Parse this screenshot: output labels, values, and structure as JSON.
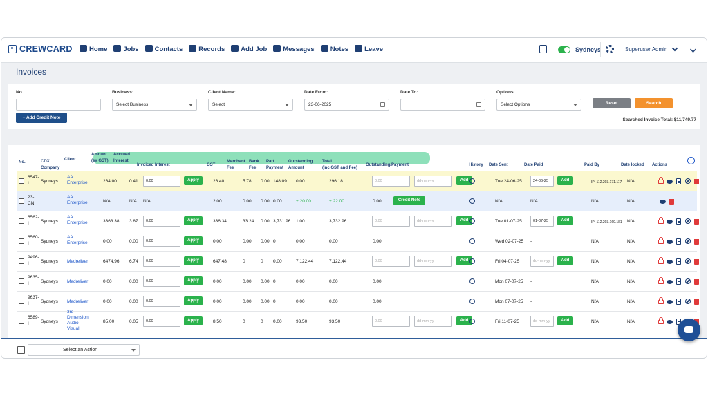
{
  "brand": {
    "name": "CREWCARD"
  },
  "nav": [
    {
      "label": "Home",
      "icon": "home-icon"
    },
    {
      "label": "Jobs",
      "icon": "list-icon"
    },
    {
      "label": "Contacts",
      "icon": "contact-icon"
    },
    {
      "label": "Records",
      "icon": "records-icon"
    },
    {
      "label": "Add Job",
      "icon": "plus-square-icon"
    },
    {
      "label": "Messages",
      "icon": "chat-bubbles-icon"
    },
    {
      "label": "Notes",
      "icon": "note-icon"
    },
    {
      "label": "Leave",
      "icon": "calendar-x-icon"
    }
  ],
  "topright": {
    "location": "Sydneys",
    "user": "Superuser Admin"
  },
  "page": {
    "title": "Invoices"
  },
  "filters": {
    "no_label": "No.",
    "no_value": "",
    "business_label": "Business:",
    "business_value": "Select Business",
    "client_label": "Client Name:",
    "client_value": "Select",
    "date_from_label": "Date From:",
    "date_from_value": "23-06-2025",
    "date_to_label": "Date To:",
    "date_to_value": "",
    "options_label": "Options:",
    "options_value": "Select Options",
    "reset": "Reset",
    "search": "Search",
    "add_credit_note": "+ Add Credit Note",
    "total_text": "Searched Invoice Total: $11,749.77"
  },
  "columns": {
    "no": "No.",
    "cdx": [
      "CDX",
      "Company"
    ],
    "client": "Client",
    "amount": [
      "Amount",
      "(ex GST)"
    ],
    "accrued": [
      "Accrued",
      "Interest"
    ],
    "invoiced": "Invoiced Interest",
    "gst": "GST",
    "merchant": [
      "Merchant",
      "Fee"
    ],
    "bank": [
      "Bank",
      "Fee"
    ],
    "part": [
      "Part",
      "Payment"
    ],
    "outstanding": [
      "Outstanding",
      "Amount"
    ],
    "total": [
      "Total",
      "(inc GST and Fee)"
    ],
    "outpay": "Outstanding/Payment",
    "history": "History",
    "date_sent": "Date Sent",
    "date_paid": "Date Paid",
    "paid_by": "Paid By",
    "date_locked": "Date locked",
    "actions": "Actions"
  },
  "labels": {
    "apply": "Apply",
    "add": "Add",
    "credit_note": "Credit Note",
    "placeholder_amt": "0.00",
    "placeholder_date": "dd-mm-yy"
  },
  "rows": [
    {
      "no": [
        "6547-",
        "I"
      ],
      "cdx": "Sydneys",
      "client": [
        "AA",
        "Enterprise"
      ],
      "amount": "264.00",
      "accrued": "0.41",
      "invoiced": "0.00",
      "gst": "26.40",
      "merchant": "5.78",
      "bank": "0.00",
      "part": "148.09",
      "outstanding": "0.00",
      "total": "296.18",
      "outpay": "",
      "date_sent": "Tue 24-06-25",
      "date_paid": "24-06-25",
      "paid_by": "IP: 112.203.171.117",
      "locked": "N/A",
      "bg": "#fbf8cf",
      "type": "invoice",
      "apply": true,
      "add": true,
      "paid_input": true
    },
    {
      "no": [
        "23-",
        "CN"
      ],
      "cdx": "",
      "client": [
        "AA",
        "Enterprise"
      ],
      "amount": "N/A",
      "accrued": "N/A",
      "invoiced": "N/A",
      "gst": "2.00",
      "merchant": "0.00",
      "bank": "0.00",
      "part": "0.00",
      "outstanding": "+ 20.00",
      "total": "+ 22.00",
      "outpay": "0.00",
      "date_sent": "N/A",
      "date_paid": "N/A",
      "paid_by": "N/A",
      "locked": "N/A",
      "bg": "#e6eefb",
      "type": "credit"
    },
    {
      "no": [
        "6562-",
        "I"
      ],
      "cdx": "Sydneys",
      "client": [
        "AA",
        "Enterprise"
      ],
      "amount": "3363.38",
      "accrued": "3.87",
      "invoiced": "0.00",
      "gst": "336.34",
      "merchant": "33.24",
      "bank": "0.00",
      "part": "3,731.96",
      "outstanding": "1.00",
      "total": "3,732.96",
      "outpay": "",
      "date_sent": "Tue 01-07-25",
      "date_paid": "01-07-25",
      "paid_by": "IP: 112.203.169.181",
      "locked": "N/A",
      "bg": "#ffffff",
      "type": "invoice",
      "apply": true,
      "add": true,
      "paid_input": true
    },
    {
      "no": [
        "6560-",
        "I"
      ],
      "cdx": "Sydneys",
      "client": [
        "AA",
        "Enterprise"
      ],
      "amount": "0.00",
      "accrued": "0.00",
      "invoiced": "0.00",
      "gst": "0.00",
      "merchant": "0.00",
      "bank": "0.00",
      "part": "0",
      "outstanding": "0.00",
      "total": "0.00",
      "outpay": "0.00",
      "date_sent": "Wed 02-07-25",
      "date_paid": "-",
      "paid_by": "N/A",
      "locked": "N/A",
      "bg": "#ffffff",
      "type": "invoice",
      "apply": true,
      "add": false,
      "paid_input": false
    },
    {
      "no": [
        "9496-",
        "I"
      ],
      "cdx": "Sydneys",
      "client": [
        "Medreliver"
      ],
      "amount": "6474.96",
      "accrued": "6.74",
      "invoiced": "0.00",
      "gst": "647.48",
      "merchant": "0",
      "bank": "0",
      "part": "0.00",
      "outstanding": "7,122.44",
      "total": "7,122.44",
      "outpay": "",
      "date_sent": "Fri 04-07-25",
      "date_paid": "",
      "paid_by": "N/A",
      "locked": "N/A",
      "bg": "#ffffff",
      "type": "invoice",
      "apply": true,
      "add": true,
      "paid_input": true
    },
    {
      "no": [
        "9635-",
        "I"
      ],
      "cdx": "Sydneys",
      "client": [
        "Medreliver"
      ],
      "amount": "0.00",
      "accrued": "0.00",
      "invoiced": "0.00",
      "gst": "0.00",
      "merchant": "0.00",
      "bank": "0.00",
      "part": "0",
      "outstanding": "0.00",
      "total": "0.00",
      "outpay": "0.00",
      "date_sent": "Mon 07-07-25",
      "date_paid": "-",
      "paid_by": "N/A",
      "locked": "N/A",
      "bg": "#ffffff",
      "type": "invoice",
      "apply": true,
      "add": false,
      "paid_input": false
    },
    {
      "no": [
        "9637-",
        "I"
      ],
      "cdx": "Sydneys",
      "client": [
        "Medreliver"
      ],
      "amount": "0.00",
      "accrued": "0.00",
      "invoiced": "0.00",
      "gst": "0.00",
      "merchant": "0.00",
      "bank": "0.00",
      "part": "0",
      "outstanding": "0.00",
      "total": "0.00",
      "outpay": "0.00",
      "date_sent": "Mon 07-07-25",
      "date_paid": "-",
      "paid_by": "N/A",
      "locked": "N/A",
      "bg": "#ffffff",
      "type": "invoice",
      "apply": true,
      "add": false,
      "paid_input": false
    },
    {
      "no": [
        "6589-",
        "I"
      ],
      "cdx": "Sydneys",
      "client": [
        "3rd",
        "Dimension",
        "Audio",
        "Visual"
      ],
      "amount": "85.00",
      "accrued": "0.05",
      "invoiced": "0.00",
      "gst": "8.50",
      "merchant": "0",
      "bank": "0",
      "part": "0.00",
      "outstanding": "93.50",
      "total": "93.50",
      "outpay": "",
      "date_sent": "Fri 11-07-25",
      "date_paid": "",
      "paid_by": "N/A",
      "locked": "N/A",
      "bg": "#ffffff",
      "type": "invoice",
      "apply": true,
      "add": true,
      "paid_input": true
    }
  ],
  "bottom": {
    "action_select": "Select an Action"
  }
}
